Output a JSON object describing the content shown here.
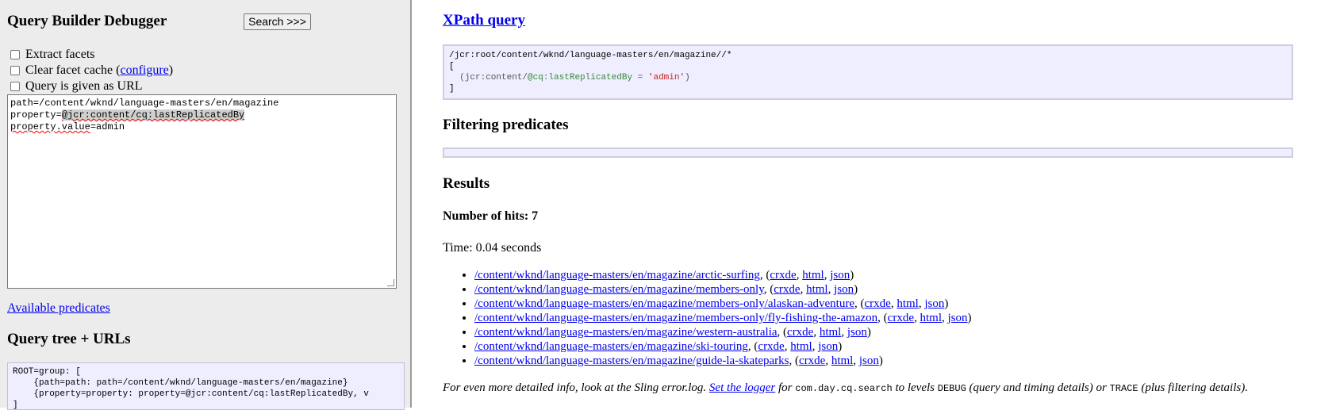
{
  "left_panel": {
    "title": "Query Builder Debugger",
    "search_button": "Search >>>",
    "options": [
      {
        "label": "Extract facets",
        "checked": false
      },
      {
        "label_before": "Clear facet cache (",
        "link": "configure",
        "label_after": ")",
        "checked": false
      },
      {
        "label": "Query is given as URL",
        "checked": false
      }
    ],
    "query_lines": {
      "line1": "path=/content/wknd/language-masters/en/magazine",
      "line2_prefix": "property=",
      "line2_value": "@jcr:content/cq:lastReplicatedBy",
      "line3_key": "property.value",
      "line3_value": "=admin"
    },
    "available_predicates": "Available predicates",
    "query_tree_title": "Query tree + URLs",
    "query_tree_lines": [
      "ROOT=group: [",
      "    {path=path: path=/content/wknd/language-masters/en/magazine}",
      "    {property=property: property=@jcr:content/cq:lastReplicatedBy, v",
      "]"
    ]
  },
  "xpath": {
    "title": "XPath query",
    "line1": "/jcr:root/content/wknd/language-masters/en/magazine//*",
    "line2": "[",
    "line3_a": "  (jcr:content/",
    "line3_b": "@cq:lastReplicatedBy",
    "line3_c": " = ",
    "line3_d": "'admin'",
    "line3_e": ")",
    "line4": "]"
  },
  "filtering": {
    "title": "Filtering predicates"
  },
  "results": {
    "title": "Results",
    "hits_label": "Number of hits: 7",
    "time_label": "Time: 0.04 seconds",
    "items": [
      {
        "path": "/content/wknd/language-masters/en/magazine/arctic-surfing",
        "crxde": "crxde",
        "html": "html",
        "json": "json"
      },
      {
        "path": "/content/wknd/language-masters/en/magazine/members-only",
        "crxde": "crxde",
        "html": "html",
        "json": "json"
      },
      {
        "path": "/content/wknd/language-masters/en/magazine/members-only/alaskan-adventure",
        "crxde": "crxde",
        "html": "html",
        "json": "json"
      },
      {
        "path": "/content/wknd/language-masters/en/magazine/members-only/fly-fishing-the-amazon",
        "crxde": "crxde",
        "html": "html",
        "json": "json"
      },
      {
        "path": "/content/wknd/language-masters/en/magazine/western-australia",
        "crxde": "crxde",
        "html": "html",
        "json": "json"
      },
      {
        "path": "/content/wknd/language-masters/en/magazine/ski-touring",
        "crxde": "crxde",
        "html": "html",
        "json": "json"
      },
      {
        "path": "/content/wknd/language-masters/en/magazine/guide-la-skateparks",
        "crxde": "crxde",
        "html": "html",
        "json": "json"
      }
    ]
  },
  "footer_note": {
    "part1": "For even more detailed info, look at the Sling error.log. ",
    "link": "Set the logger",
    "part2": " for ",
    "code1": "com.day.cq.search",
    "part3": " to levels ",
    "code2": "DEBUG",
    "part4": " (query and timing details) or ",
    "code3": "TRACE",
    "part5": " (plus filtering details)."
  }
}
